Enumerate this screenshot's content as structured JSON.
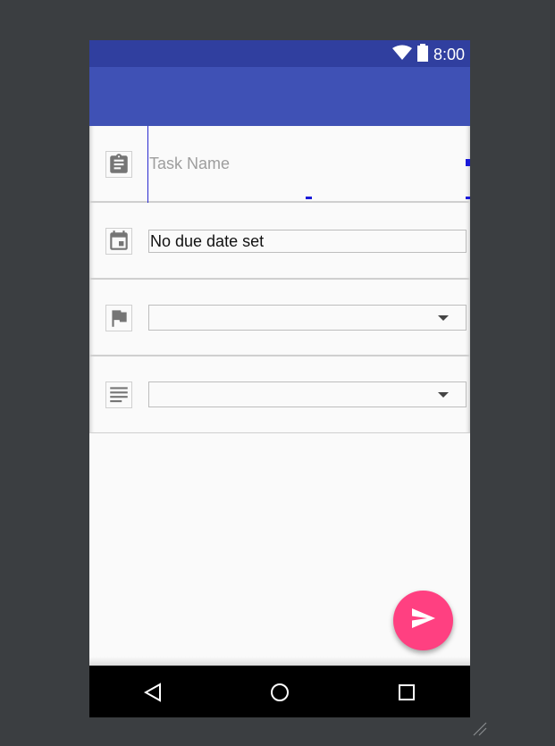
{
  "status_bar": {
    "time": "8:00",
    "icons": [
      "wifi-icon",
      "battery-icon"
    ]
  },
  "form": {
    "task_name": {
      "placeholder": "Task Name",
      "value": "",
      "icon": "clipboard-icon"
    },
    "due_date": {
      "value": "No due date set",
      "icon": "calendar-icon"
    },
    "priority": {
      "value": "",
      "icon": "flag-icon"
    },
    "category": {
      "value": "",
      "icon": "list-icon"
    }
  },
  "fab": {
    "icon": "send-icon"
  },
  "nav_bar": {
    "icons": [
      "back-icon",
      "home-icon",
      "recents-icon"
    ]
  },
  "colors": {
    "status_bar": "#303f9f",
    "app_bar": "#3f51b5",
    "fab": "#ff4081",
    "background": "#fafafa",
    "icon": "#757575"
  }
}
